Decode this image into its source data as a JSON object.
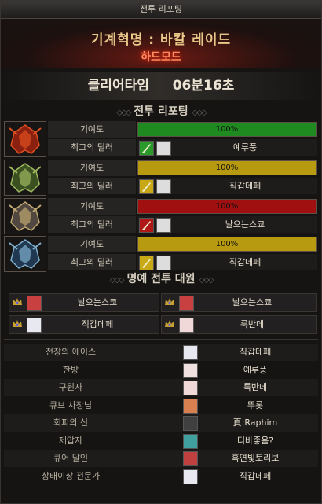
{
  "window": {
    "title": "전투 리포팅"
  },
  "raid": {
    "name": "기계혁명 : 바칼 레이드",
    "difficulty": "하드모드"
  },
  "clear": {
    "label": "클리어타임",
    "time": "06분16초"
  },
  "report": {
    "title": "전투 리포팅",
    "contribution_label": "기여도",
    "best_dealer_label": "최고의 딜러",
    "bosses": [
      {
        "icon": "red-dragon-boss-icon",
        "bar_color": "#1f8a1f",
        "percent_text": "100%",
        "percent": 100,
        "skill_color": "#2a9a2a",
        "skill_icon": "green-skill-icon",
        "dealer": "예루풍"
      },
      {
        "icon": "green-dragon-boss-icon",
        "bar_color": "#b89a10",
        "percent_text": "100%",
        "percent": 100,
        "skill_color": "#c8a814",
        "skill_icon": "yellow-skill-icon",
        "dealer": "직갑데페"
      },
      {
        "icon": "gold-dragon-boss-icon",
        "bar_color": "#a01010",
        "percent_text": "100%",
        "percent": 100,
        "skill_color": "#b01818",
        "skill_icon": "red-skill-icon",
        "dealer": "날으는스쿄"
      },
      {
        "icon": "blue-dragon-boss-icon",
        "bar_color": "#b89a10",
        "percent_text": "100%",
        "percent": 100,
        "skill_color": "#c8a814",
        "skill_icon": "yellow-skill-icon",
        "dealer": "직갑데페"
      }
    ]
  },
  "honor": {
    "title": "명예 전투 대원",
    "members": [
      "날으는스쿄",
      "날으는스쿄",
      "직갑데페",
      "룩반데"
    ]
  },
  "awards": [
    {
      "title": "전장의 에이스",
      "name": "직갑데페"
    },
    {
      "title": "한방",
      "name": "예루풍"
    },
    {
      "title": "구원자",
      "name": "룩반데"
    },
    {
      "title": "큐브 사장님",
      "name": "뚜롯"
    },
    {
      "title": "회피의 신",
      "name": "頁:Raphim"
    },
    {
      "title": "제압자",
      "name": "디바좋음?"
    },
    {
      "title": "큐어 달인",
      "name": "흑연빛토리보"
    },
    {
      "title": "상태이상 전문가",
      "name": "직갑데페"
    }
  ]
}
